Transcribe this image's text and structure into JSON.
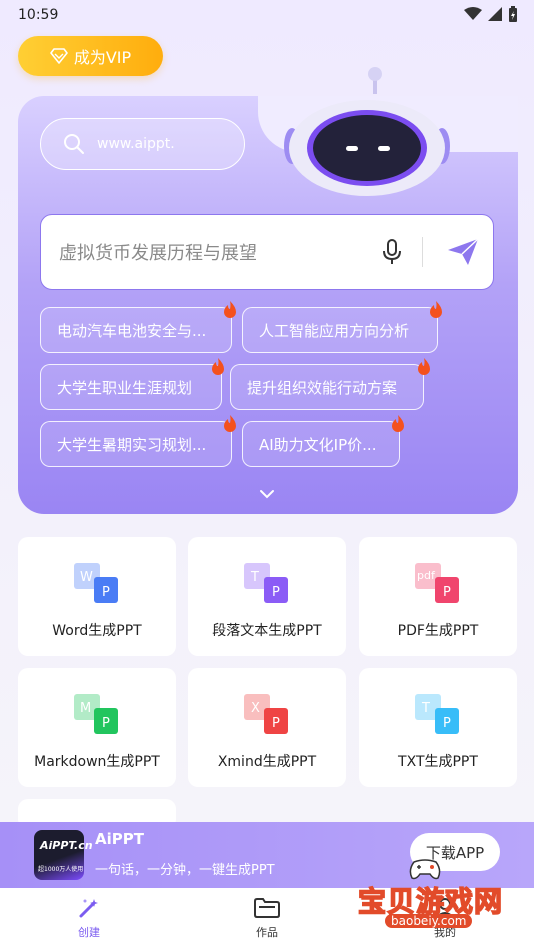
{
  "status_bar": {
    "time": "10:59"
  },
  "vip_button": {
    "label": "成为VIP"
  },
  "hero": {
    "url_text": "www.aippt.",
    "search_placeholder": "虚拟货币发展历程与展望",
    "chips": [
      "电动汽车电池安全与...",
      "人工智能应用方向分析",
      "大学生职业生涯规划",
      "提升组织效能行动方案",
      "大学生暑期实习规划...",
      "AI助力文化IP价..."
    ]
  },
  "tools": [
    {
      "label": "Word生成PPT",
      "letter": "W",
      "color": "#4a7cf5"
    },
    {
      "label": "段落文本生成PPT",
      "letter": "T",
      "color": "#8b5cf6"
    },
    {
      "label": "PDF生成PPT",
      "letter": "pdf",
      "color": "#f0456d"
    },
    {
      "label": "Markdown生成PPT",
      "letter": "M",
      "color": "#22c55e"
    },
    {
      "label": "Xmind生成PPT",
      "letter": "X",
      "color": "#ef4444"
    },
    {
      "label": "TXT生成PPT",
      "letter": "T",
      "color": "#38bdf8"
    }
  ],
  "banner": {
    "app_name": "AiPPT",
    "slogan": "一句话，一分钟，一键生成PPT",
    "download_label": "下载APP",
    "logo_text": "AiPPT.cn",
    "logo_sub": "超1000万人使用"
  },
  "nav": {
    "items": [
      {
        "label": "创建",
        "active": true
      },
      {
        "label": "作品",
        "active": false
      },
      {
        "label": "我的",
        "active": false
      }
    ]
  },
  "watermark": {
    "text": "宝贝游戏网",
    "url": "baobeiy.com"
  },
  "colors": {
    "accent": "#8d77ee",
    "vip": "#ffb81c"
  }
}
